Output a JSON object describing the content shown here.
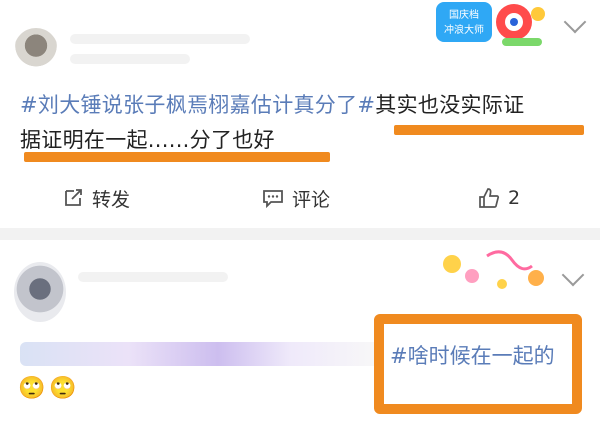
{
  "post1": {
    "hashtag": "#刘大锤说张子枫焉栩嘉估计真分了#",
    "text_line1_rest": "其实也没实际证",
    "text_line2": "据证明在一起......分了也好",
    "badge_text_line1": "国庆档",
    "badge_text_line2": "冲浪大师",
    "actions": {
      "repost_label": "转发",
      "comment_label": "评论",
      "like_count": "2"
    }
  },
  "post2": {
    "hashtag": "#啥时候在一起的",
    "emojis": [
      "🙄",
      "🙄"
    ]
  },
  "colors": {
    "hashtag": "#5a7cb8",
    "highlight": "#f08a1f",
    "separator": "#f2f2f2"
  },
  "icons": {
    "repost": "share-icon",
    "comment": "comment-icon",
    "like": "thumbs-up-icon",
    "more": "chevron-down-icon"
  }
}
